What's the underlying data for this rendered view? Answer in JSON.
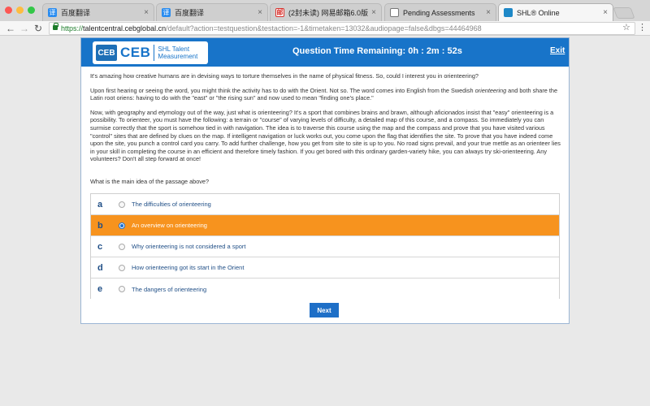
{
  "browser": {
    "tabs": [
      {
        "title": "百度翻译",
        "icon": "baidu-translate-icon"
      },
      {
        "title": "百度翻译",
        "icon": "baidu-translate-icon"
      },
      {
        "title": "(2封未读) 网易邮箱6.0版",
        "icon": "netease-mail-icon"
      },
      {
        "title": "Pending Assessments",
        "icon": "document-icon"
      },
      {
        "title": "SHL® Online",
        "icon": "shl-icon"
      }
    ],
    "url": {
      "scheme": "https://",
      "host": "talentcentral.cebglobal.cn",
      "path": "/default?action=testquestion&testaction=-1&timetaken=13032&audiopage=false&dbgs=44464968"
    }
  },
  "header": {
    "logo_mark": "CEB",
    "logo_text": "CEB",
    "logo_sub_line1": "SHL Talent",
    "logo_sub_line2": "Measurement",
    "timer": "Question Time Remaining: 0h : 2m : 52s",
    "exit": "Exit"
  },
  "passage": {
    "p1": "It's amazing how creative humans are in devising ways to torture themselves in the name of physical fitness. So, could I interest you in orienteering?",
    "p2a": "Upon first hearing or seeing the word, you might think the activity has to do with the Orient. Not so. The word comes into English from the Swedish ",
    "p2_em": "orienteering",
    "p2b": " and both share the Latin root oriens: having to do with the \"east\" or \"the rising sun\" and now used to mean \"finding one's place.\"",
    "p3": "Now, with geography and etymology out of the way, just what is orienteering? It's a sport that combines brains and brawn, although aficionados insist that \"easy\" orienteering is a possibility. To orienteer, you must have the following: a terrain or \"course\" of varying levels of difficulty, a detailed map of this course, and a compass. So immediately you can surmise correctly that the sport is somehow tied in with navigation. The idea is to traverse this course using the map and the compass and prove that you have visited various \"control\" sites that are defined by clues on the map. If intelligent navigation or luck works out, you come upon the flag that identifies the site. To prove that you have indeed come upon the site, you punch a control card you carry. To add further challenge, how you get from site to site is up to you. No road signs prevail, and your true mettle as an orienteer lies in your skill in completing the course in an efficient and therefore timely fashion. If you get bored with this ordinary garden-variety hike, you can always try ski-orienteering. Any volunteers? Don't all step forward at once!"
  },
  "question": "What is the main idea of the passage above?",
  "options": [
    {
      "letter": "a",
      "text": "The difficulties of orienteering",
      "selected": false
    },
    {
      "letter": "b",
      "text": "An overview on orienteering",
      "selected": true
    },
    {
      "letter": "c",
      "text": "Why orienteering is not considered a sport",
      "selected": false
    },
    {
      "letter": "d",
      "text": "How orienteering got its start in the Orient",
      "selected": false
    },
    {
      "letter": "e",
      "text": "The dangers of orienteering",
      "selected": false
    }
  ],
  "next_label": "Next",
  "colors": {
    "header_blue": "#1874c9",
    "selected_orange": "#f7931e",
    "option_text": "#1f4e86"
  }
}
